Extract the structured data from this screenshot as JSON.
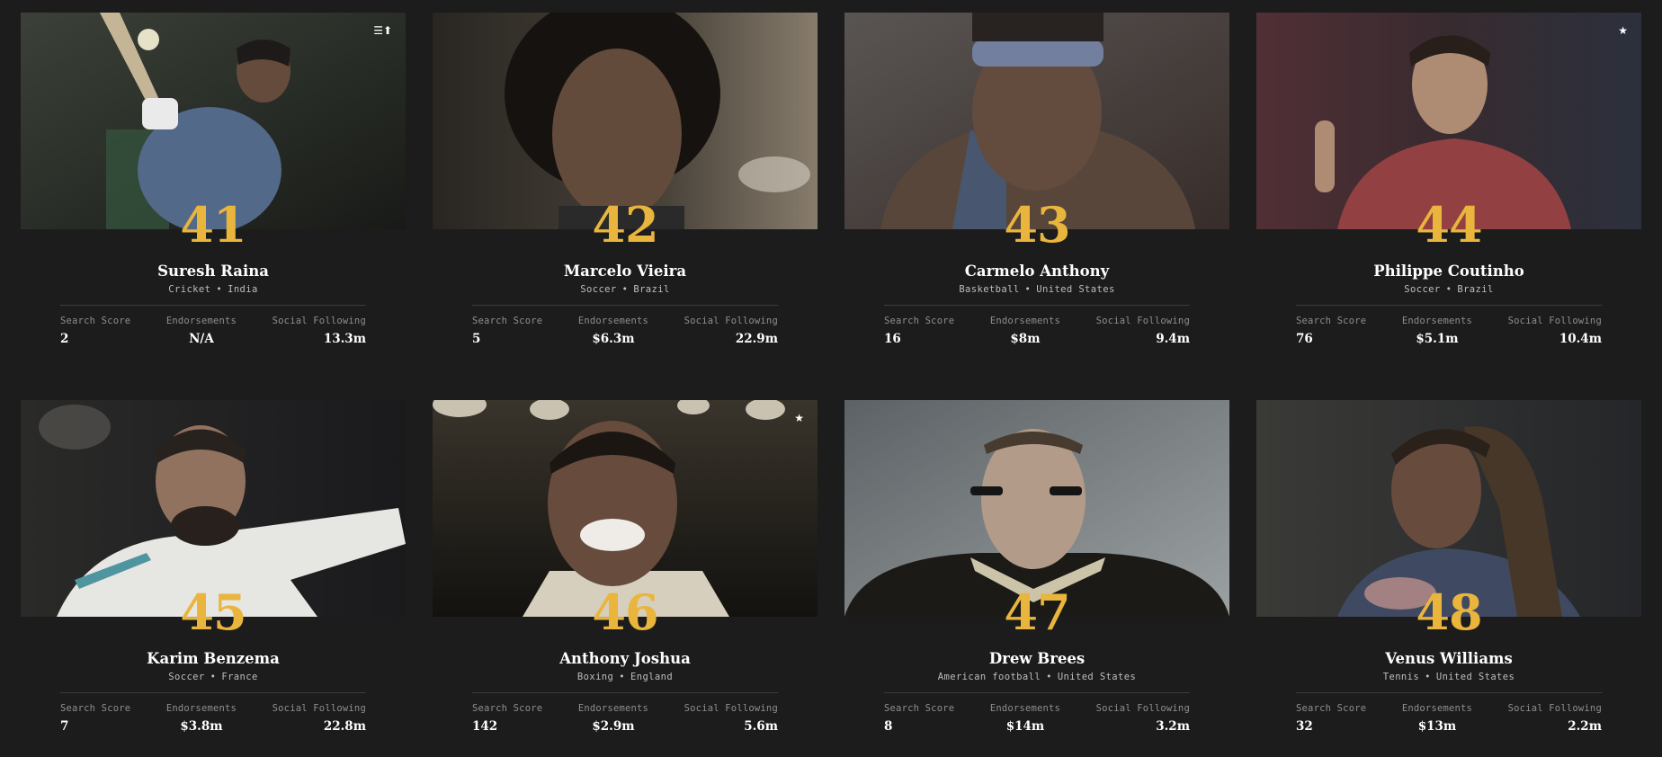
{
  "labels": {
    "search_score": "Search Score",
    "endorsements": "Endorsements",
    "social_following": "Social Following"
  },
  "colors": {
    "background": "#1c1c1c",
    "rank": "#e9b53c",
    "text": "#ffffff",
    "muted": "#8e8e8e"
  },
  "athletes": [
    {
      "rank": "41",
      "name": "Suresh Raina",
      "sport": "Cricket",
      "country": "India",
      "search_score": "2",
      "endorsements": "N/A",
      "social_following": "13.3m",
      "corner_icon": "sort-up-icon",
      "corner_glyph": "☰⬆"
    },
    {
      "rank": "42",
      "name": "Marcelo Vieira",
      "sport": "Soccer",
      "country": "Brazil",
      "search_score": "5",
      "endorsements": "$6.3m",
      "social_following": "22.9m"
    },
    {
      "rank": "43",
      "name": "Carmelo Anthony",
      "sport": "Basketball",
      "country": "United States",
      "search_score": "16",
      "endorsements": "$8m",
      "social_following": "9.4m"
    },
    {
      "rank": "44",
      "name": "Philippe Coutinho",
      "sport": "Soccer",
      "country": "Brazil",
      "search_score": "76",
      "endorsements": "$5.1m",
      "social_following": "10.4m",
      "corner_icon": "star-icon",
      "corner_glyph": "★"
    },
    {
      "rank": "45",
      "name": "Karim Benzema",
      "sport": "Soccer",
      "country": "France",
      "search_score": "7",
      "endorsements": "$3.8m",
      "social_following": "22.8m"
    },
    {
      "rank": "46",
      "name": "Anthony Joshua",
      "sport": "Boxing",
      "country": "England",
      "search_score": "142",
      "endorsements": "$2.9m",
      "social_following": "5.6m",
      "corner_icon": "star-icon",
      "corner_glyph": "★"
    },
    {
      "rank": "47",
      "name": "Drew Brees",
      "sport": "American football",
      "country": "United States",
      "search_score": "8",
      "endorsements": "$14m",
      "social_following": "3.2m"
    },
    {
      "rank": "48",
      "name": "Venus Williams",
      "sport": "Tennis",
      "country": "United States",
      "search_score": "32",
      "endorsements": "$13m",
      "social_following": "2.2m"
    }
  ]
}
